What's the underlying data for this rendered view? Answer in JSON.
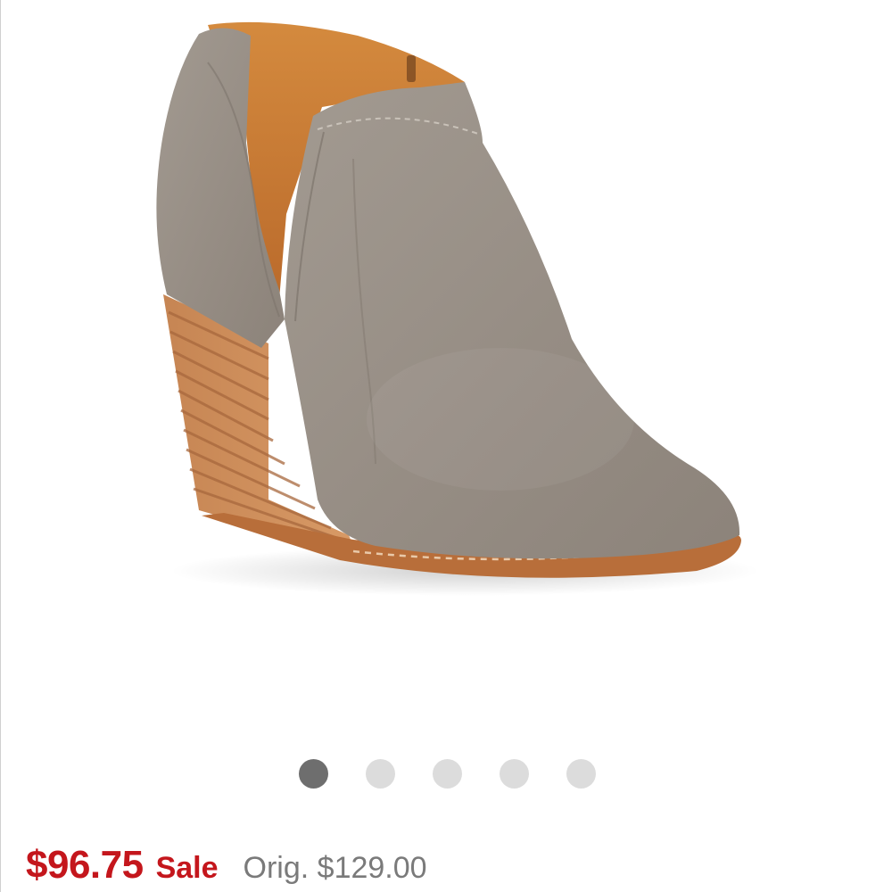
{
  "product": {
    "image_alt": "Taupe suede wedge ankle bootie with stacked wood wedge heel and side cutout",
    "colors": {
      "suede": "#9a9289",
      "wedge": "#c98a58",
      "lining": "#c7762f"
    }
  },
  "carousel": {
    "total": 5,
    "active_index": 0,
    "colors": {
      "active": "#6e6e6e",
      "inactive": "#dcdcdc"
    }
  },
  "pricing": {
    "sale_price": "$96.75",
    "sale_label": "Sale",
    "original_price": "Orig. $129.00",
    "colors": {
      "sale": "#c4161c",
      "original": "#7a7a7a"
    }
  }
}
